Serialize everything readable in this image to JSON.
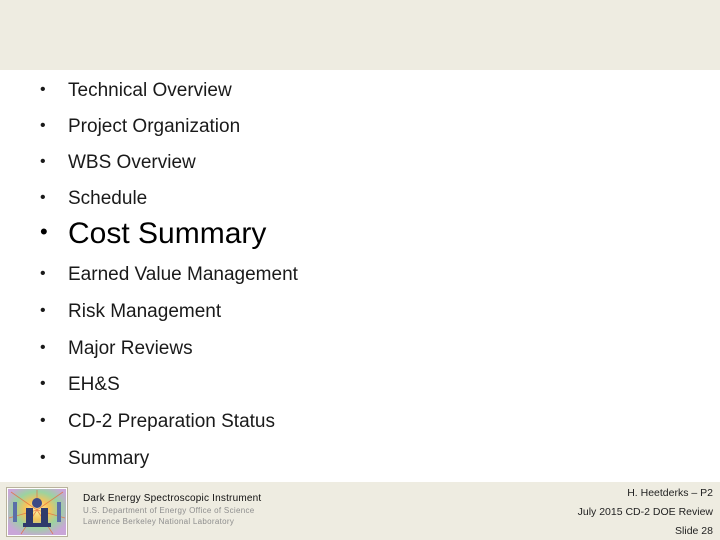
{
  "agenda": [
    {
      "label": "Technical Overview"
    },
    {
      "label": "Project Organization"
    },
    {
      "label": "WBS Overview"
    },
    {
      "label": "Schedule"
    },
    {
      "label": "Cost Summary",
      "highlighted": true
    },
    {
      "label": "Earned Value Management"
    },
    {
      "label": "Risk Management"
    },
    {
      "label": "Major Reviews"
    },
    {
      "label": "EH&S"
    },
    {
      "label": "CD-2 Preparation Status"
    },
    {
      "label": "Summary"
    }
  ],
  "bullet_char": "•",
  "footer": {
    "org_name": "Dark Energy Spectroscopic Instrument",
    "org_line_1": "U.S. Department of Energy Office of Science",
    "org_line_2": "Lawrence Berkeley National Laboratory",
    "presenter": "H. Heetderks – P2",
    "event": "July 2015 CD-2 DOE Review",
    "slide": "Slide 28"
  },
  "colors": {
    "band": "#eeece1",
    "text": "#1a1a1a"
  },
  "icons": {
    "logo": "desi-instrument-logo-icon"
  }
}
